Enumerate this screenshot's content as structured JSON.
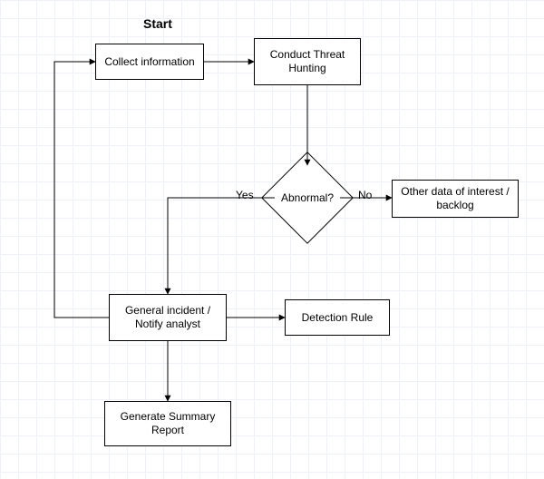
{
  "diagram": {
    "title": "Start",
    "nodes": {
      "collect": {
        "label": "Collect information"
      },
      "hunt": {
        "label": "Conduct Threat Hunting"
      },
      "abnormal": {
        "label": "Abnormal?"
      },
      "backlog": {
        "label": "Other data of interest / backlog"
      },
      "incident": {
        "label": "General incident / Notify analyst"
      },
      "rule": {
        "label": "Detection Rule"
      },
      "report": {
        "label": "Generate Summary Report"
      }
    },
    "edges": {
      "yes": "Yes",
      "no": "No"
    }
  }
}
